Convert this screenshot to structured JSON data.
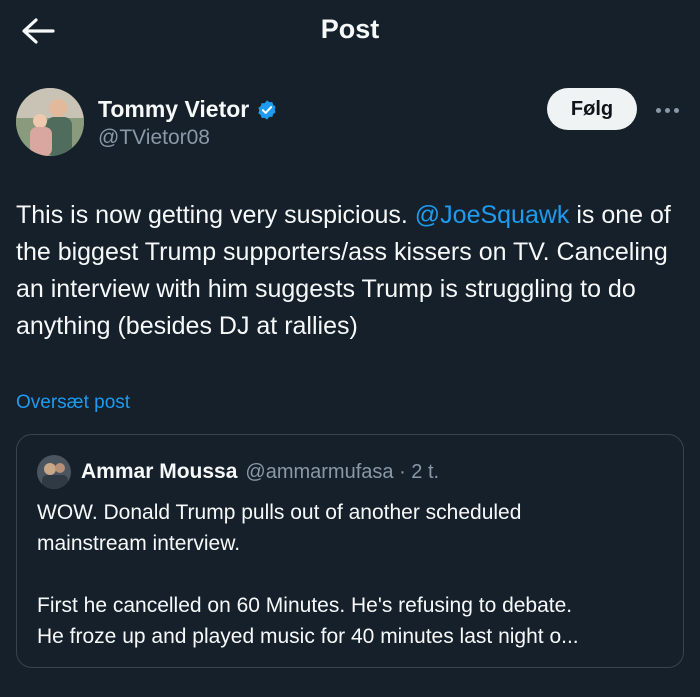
{
  "header": {
    "title": "Post",
    "back_icon": "arrow-left-icon"
  },
  "author": {
    "display_name": "Tommy Vietor",
    "handle": "@TVietor08",
    "verified_icon": "verified-badge-icon",
    "follow_label": "Følg",
    "more_icon": "more-dots-icon"
  },
  "post": {
    "text_part1": "This is now getting very suspicious. ",
    "mention": "@JoeSquawk",
    "text_part2": " is one of the biggest Trump supporters/ass kissers on TV. Canceling an interview with him suggests Trump is struggling to do anything (besides DJ at rallies)",
    "translate_label": "Oversæt post"
  },
  "quote": {
    "display_name": "Ammar Moussa",
    "meta": "@ammarmufasa · 2 t.",
    "line1": "WOW. Donald Trump pulls out of another scheduled",
    "line2": "mainstream interview.",
    "line3": "First he cancelled on 60 Minutes. He's refusing to debate.",
    "line4": "He froze up and played music for 40 minutes last night o..."
  },
  "colors": {
    "background": "#15202b",
    "accent": "#1d9bf0",
    "secondary_text": "#8b98a5",
    "border": "#38444d"
  }
}
